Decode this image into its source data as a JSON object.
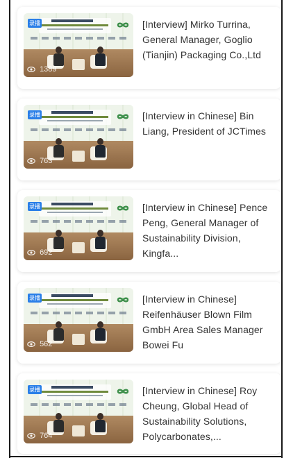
{
  "videos": [
    {
      "badge": "录播",
      "views": "1389",
      "title": "[Interview] Mirko Turrina, General Manager, Goglio (Tianjin) Packaging Co.,Ltd"
    },
    {
      "badge": "录播",
      "views": "763",
      "title": "[Interview in Chinese] Bin Liang, President of JCTimes"
    },
    {
      "badge": "录播",
      "views": "692",
      "title": "[Interview in Chinese] Pence Peng, General Manager of Sustainability Division, Kingfa..."
    },
    {
      "badge": "录播",
      "views": "562",
      "title": "[Interview in Chinese] Reifenhäuser Blown Film GmbH Area Sales Manager Bowei Fu"
    },
    {
      "badge": "录播",
      "views": "764",
      "title": "[Interview in Chinese] Roy Cheung, Global Head of Sustainability Solutions, Polycarbonates,..."
    }
  ],
  "icons": {
    "views": "eye-icon",
    "event_logo": "infinity-loop-icon"
  },
  "colors": {
    "badge": "#2a7fe8",
    "title_text": "#333333",
    "card_bg": "#ffffff"
  }
}
